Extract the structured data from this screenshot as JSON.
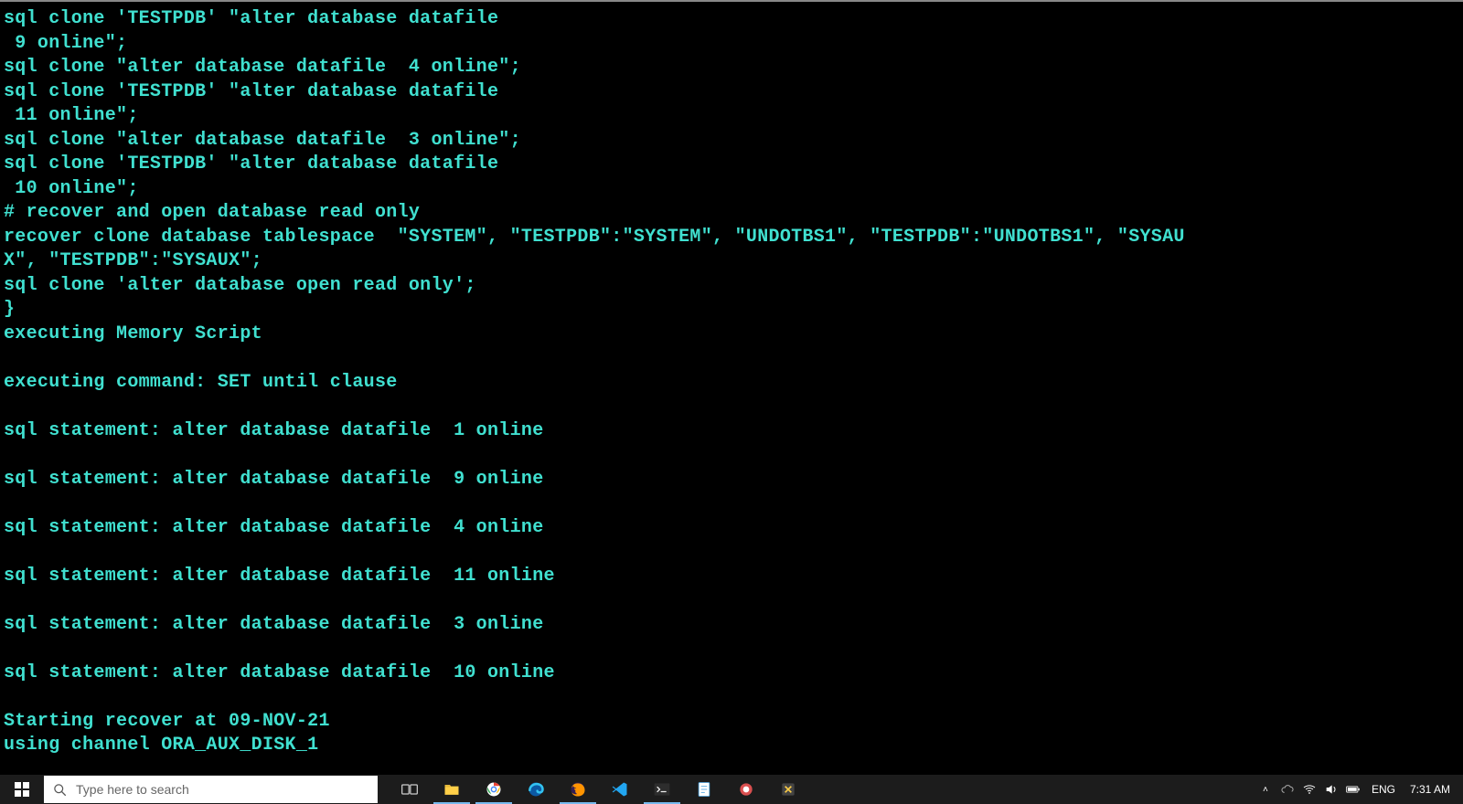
{
  "terminal": {
    "lines": [
      "sql clone 'TESTPDB' \"alter database datafile",
      " 9 online\";",
      "sql clone \"alter database datafile  4 online\";",
      "sql clone 'TESTPDB' \"alter database datafile",
      " 11 online\";",
      "sql clone \"alter database datafile  3 online\";",
      "sql clone 'TESTPDB' \"alter database datafile",
      " 10 online\";",
      "# recover and open database read only",
      "recover clone database tablespace  \"SYSTEM\", \"TESTPDB\":\"SYSTEM\", \"UNDOTBS1\", \"TESTPDB\":\"UNDOTBS1\", \"SYSAU",
      "X\", \"TESTPDB\":\"SYSAUX\";",
      "sql clone 'alter database open read only';",
      "}",
      "executing Memory Script",
      "",
      "executing command: SET until clause",
      "",
      "sql statement: alter database datafile  1 online",
      "",
      "sql statement: alter database datafile  9 online",
      "",
      "sql statement: alter database datafile  4 online",
      "",
      "sql statement: alter database datafile  11 online",
      "",
      "sql statement: alter database datafile  3 online",
      "",
      "sql statement: alter database datafile  10 online",
      "",
      "Starting recover at 09-NOV-21",
      "using channel ORA_AUX_DISK_1"
    ]
  },
  "taskbar": {
    "search_placeholder": "Type here to search",
    "language": "ENG",
    "clock": "7:31 AM"
  }
}
